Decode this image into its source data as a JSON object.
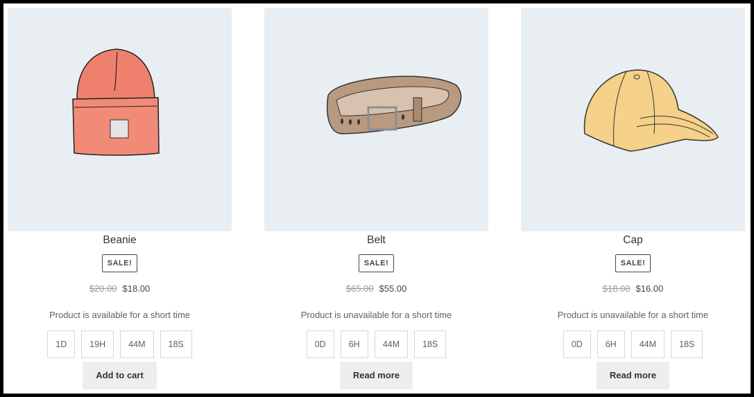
{
  "products": [
    {
      "name": "Beanie",
      "badge": "SALE!",
      "old_price": "$20.00",
      "new_price": "$18.00",
      "availability": "Product is available for a short time",
      "countdown": [
        "1D",
        "19H",
        "44M",
        "18S"
      ],
      "button": "Add to cart",
      "image_icon": "beanie-image"
    },
    {
      "name": "Belt",
      "badge": "SALE!",
      "old_price": "$65.00",
      "new_price": "$55.00",
      "availability": "Product is unavailable for a short time",
      "countdown": [
        "0D",
        "6H",
        "44M",
        "18S"
      ],
      "button": "Read more",
      "image_icon": "belt-image"
    },
    {
      "name": "Cap",
      "badge": "SALE!",
      "old_price": "$18.00",
      "new_price": "$16.00",
      "availability": "Product is unavailable for a short time",
      "countdown": [
        "0D",
        "6H",
        "44M",
        "18S"
      ],
      "button": "Read more",
      "image_icon": "cap-image"
    }
  ],
  "colors": {
    "image_bg": "#e9eef2",
    "button_bg": "#eeeeee",
    "beanie": "#f0806e",
    "belt": "#b89a80",
    "cap": "#f5d189"
  }
}
